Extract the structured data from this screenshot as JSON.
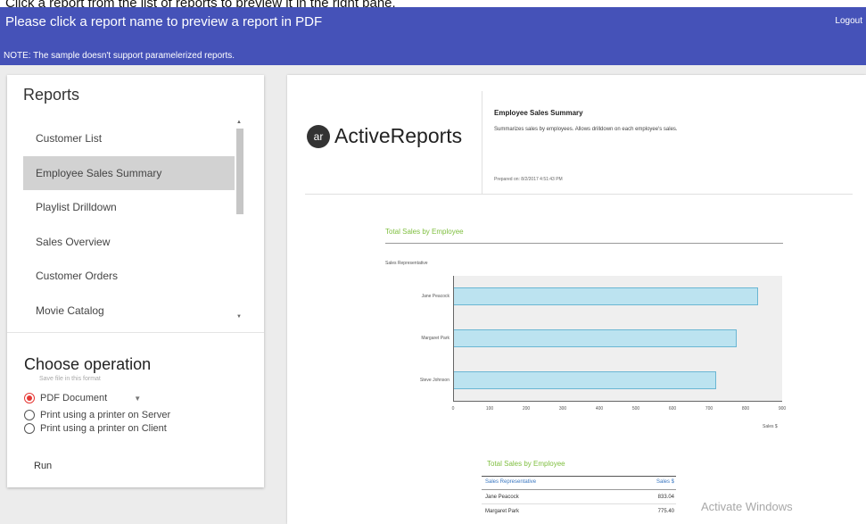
{
  "instruction": "Click a report from the list of reports to preview it in the right pane.",
  "header": {
    "title": "Please click a report name to preview a report in PDF",
    "note": "NOTE: The sample doesn't support paramelerized reports.",
    "logout_label": "Logout",
    "bg_color": "#4552b8"
  },
  "sidebar": {
    "title": "Reports",
    "items": [
      {
        "label": "Customer List"
      },
      {
        "label": "Employee Sales Summary",
        "selected": true
      },
      {
        "label": "Playlist Drilldown"
      },
      {
        "label": "Sales Overview"
      },
      {
        "label": "Customer Orders"
      },
      {
        "label": "Movie Catalog"
      }
    ]
  },
  "operation": {
    "title": "Choose operation",
    "hint": "Save file in this format",
    "options": [
      {
        "label": "PDF Document",
        "checked": true
      },
      {
        "label": "Print using a printer on Server",
        "checked": false
      },
      {
        "label": "Print using a printer on Client",
        "checked": false
      }
    ],
    "run_label": "Run",
    "accent_color": "#e53935"
  },
  "report": {
    "logo_mark": "ar",
    "logo_text": "ActiveReports",
    "title": "Employee Sales Summary",
    "description": "Summarizes sales by employees. Allows drilldown on each employee's sales.",
    "prepared": "Prepared on: 8/2/2017 4:51:43 PM",
    "table": {
      "title": "Total Sales by Employee",
      "columns": [
        "Sales Representative",
        "Sales $"
      ],
      "rows": [
        [
          "Jane Peacock",
          "833.04"
        ],
        [
          "Margaret Park",
          "775.40"
        ]
      ]
    }
  },
  "chart_data": {
    "type": "bar",
    "orientation": "horizontal",
    "title": "Total Sales by Employee",
    "ylabel": "Sales Representative",
    "xlabel": "Sales $",
    "categories": [
      "Jane Peacock",
      "Margaret Park",
      "Steve Johnson"
    ],
    "values": [
      833.04,
      775.4,
      720
    ],
    "xlim": [
      0,
      900
    ],
    "ticks": [
      "0",
      "100",
      "200",
      "300",
      "400",
      "500",
      "600",
      "700",
      "800",
      "900"
    ],
    "bar_color": "#bce3f0",
    "title_color": "#7fbf3f"
  },
  "watermark": "Activate Windows"
}
